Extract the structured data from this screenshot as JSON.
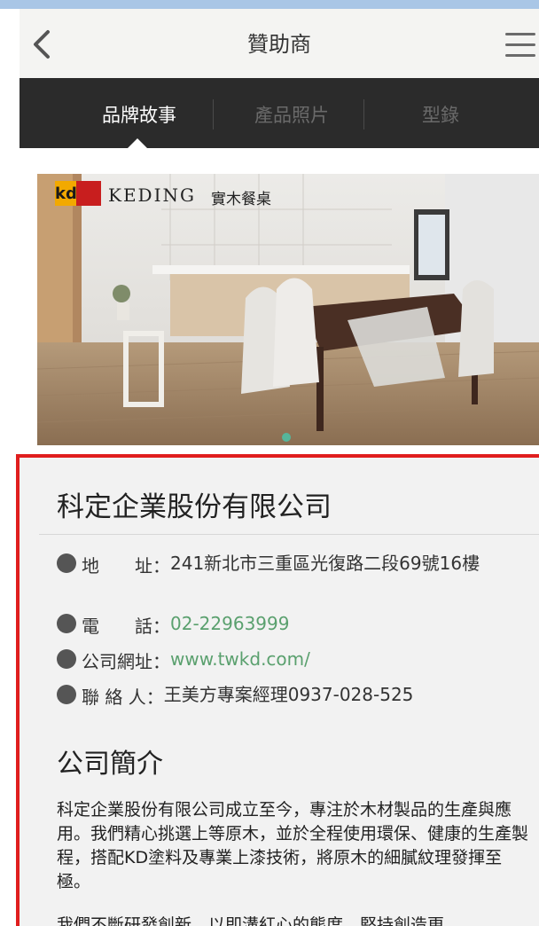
{
  "nav": {
    "title": "贊助商"
  },
  "tabs": [
    {
      "label": "品牌故事",
      "active": true
    },
    {
      "label": "產品照片",
      "active": false
    },
    {
      "label": "型錄",
      "active": false
    }
  ],
  "hero": {
    "brand_logo": "kd",
    "brand_name": "KEDING",
    "brand_sub": "實木餐桌"
  },
  "company": {
    "name": "科定企業股份有限公司",
    "address_label": "地　　址：",
    "address": "241新北市三重區光復路二段69號16樓",
    "phone_label": "電　　話：",
    "phone": "02-22963999",
    "website_label": "公司網址：",
    "website": "www.twkd.com/",
    "contact_label": "聯 絡 人：",
    "contact": "王美方專案經理0937-028-525"
  },
  "intro": {
    "title": "公司簡介",
    "paragraph1": "科定企業股份有限公司成立至今，專注於木材製品的生產與應用。我們精心挑選上等原木，並於全程使用環保、健康的生產製程，搭配KD塗料及專業上漆技術，將原木的細膩紋理發揮至極。",
    "paragraph2": "我們不斷研發創新，以即溝紅心的態度，堅持創造更"
  },
  "colors": {
    "accent": "#5aa06e",
    "tabbar": "#2b2b2b",
    "highlight_border": "#e01e1e"
  }
}
